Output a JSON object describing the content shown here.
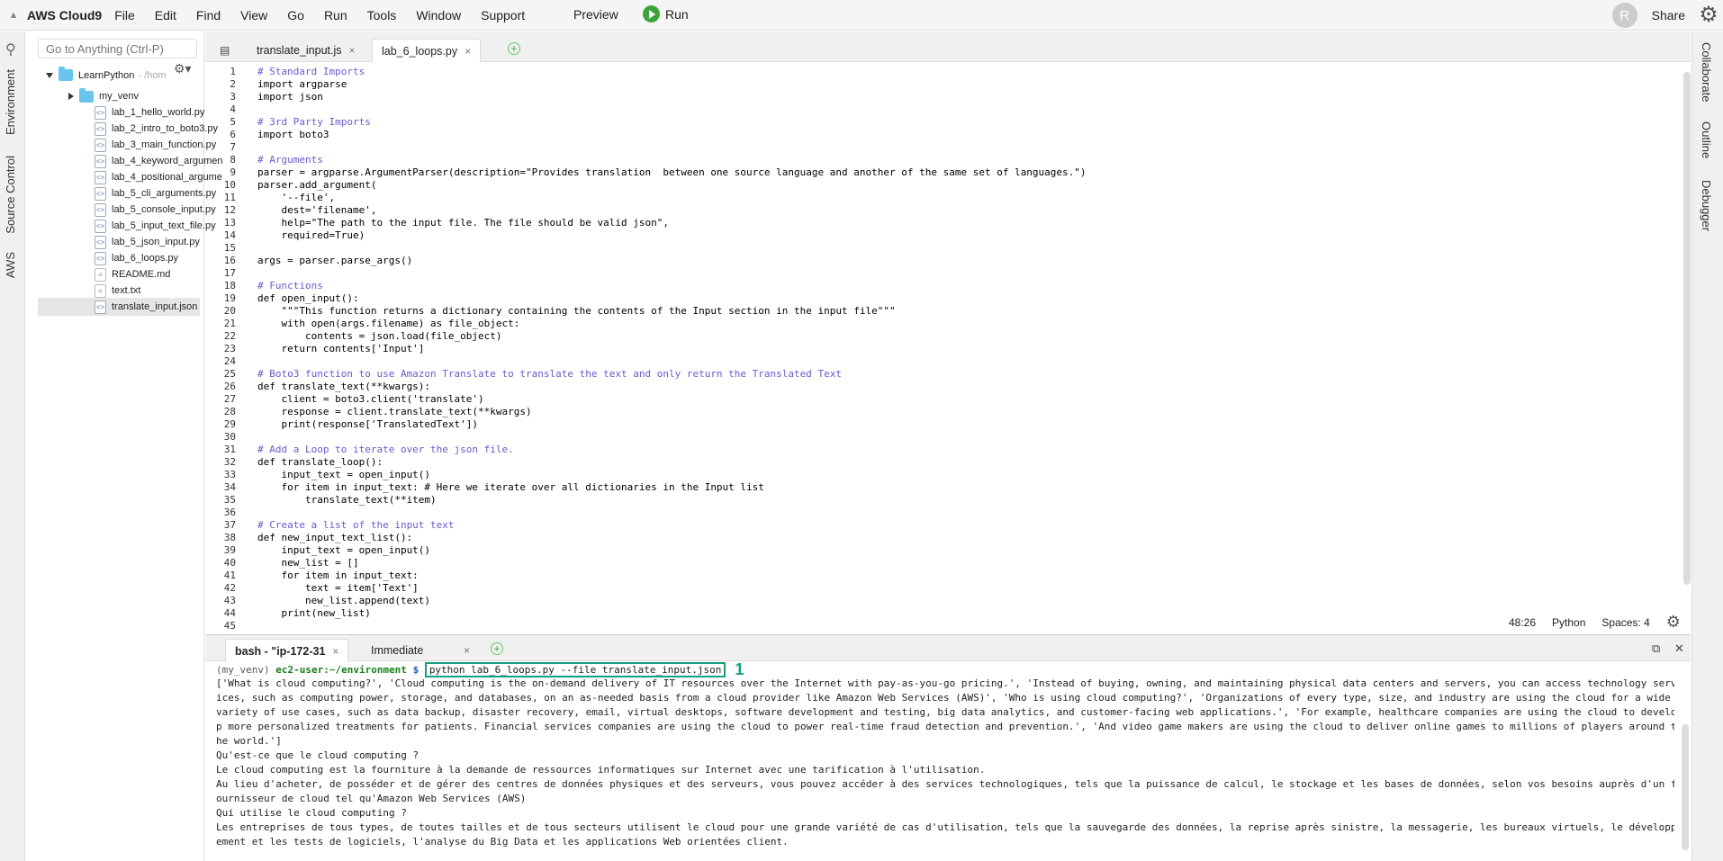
{
  "app": {
    "brand": "AWS Cloud9",
    "menu": [
      "File",
      "Edit",
      "Find",
      "View",
      "Go",
      "Run",
      "Tools",
      "Window",
      "Support"
    ],
    "preview_label": "Preview",
    "run_label": "Run",
    "avatar_letter": "R",
    "share_label": "Share"
  },
  "left_rail": {
    "tabs": [
      "Environment",
      "Source Control",
      "AWS"
    ]
  },
  "sidebar": {
    "goto_placeholder": "Go to Anything (Ctrl-P)",
    "root_name": "LearnPython",
    "root_path": "- /hom",
    "folders": [
      "my_venv"
    ],
    "files": [
      {
        "name": "lab_1_hello_world.py",
        "type": "py"
      },
      {
        "name": "lab_2_intro_to_boto3.py",
        "type": "py"
      },
      {
        "name": "lab_3_main_function.py",
        "type": "py"
      },
      {
        "name": "lab_4_keyword_argumen",
        "type": "py"
      },
      {
        "name": "lab_4_positional_argume",
        "type": "py"
      },
      {
        "name": "lab_5_cli_arguments.py",
        "type": "py"
      },
      {
        "name": "lab_5_console_input.py",
        "type": "py"
      },
      {
        "name": "lab_5_input_text_file.py",
        "type": "py"
      },
      {
        "name": "lab_5_json_input.py",
        "type": "py"
      },
      {
        "name": "lab_6_loops.py",
        "type": "py"
      },
      {
        "name": "README.md",
        "type": "doc"
      },
      {
        "name": "text.txt",
        "type": "doc"
      },
      {
        "name": "translate_input.json",
        "type": "json"
      }
    ],
    "selected_file": "translate_input.json"
  },
  "editor": {
    "tabs": [
      {
        "label": "translate_input.js",
        "close": "×"
      },
      {
        "label": "lab_6_loops.py",
        "close": "×"
      }
    ],
    "line_count": 45,
    "lines": [
      "# Standard Imports",
      "import argparse",
      "import json",
      "",
      "# 3rd Party Imports",
      "import boto3",
      "",
      "# Arguments",
      "parser = argparse.ArgumentParser(description=\"Provides translation  between one source language and another of the same set of languages.\")",
      "parser.add_argument(",
      "    '--file',",
      "    dest='filename',",
      "    help=\"The path to the input file. The file should be valid json\",",
      "    required=True)",
      "",
      "args = parser.parse_args()",
      "",
      "# Functions",
      "def open_input():",
      "    \"\"\"This function returns a dictionary containing the contents of the Input section in the input file\"\"\"",
      "    with open(args.filename) as file_object:",
      "        contents = json.load(file_object)",
      "    return contents['Input']",
      "",
      "# Boto3 function to use Amazon Translate to translate the text and only return the Translated Text",
      "def translate_text(**kwargs):",
      "    client = boto3.client('translate')",
      "    response = client.translate_text(**kwargs)",
      "    print(response['TranslatedText'])",
      "",
      "# Add a Loop to iterate over the json file.",
      "def translate_loop():",
      "    input_text = open_input()",
      "    for item in input_text: # Here we iterate over all dictionaries in the Input list",
      "        translate_text(**item)",
      "",
      "# Create a list of the input text",
      "def new_input_text_list():",
      "    input_text = open_input()",
      "    new_list = []",
      "    for item in input_text:",
      "        text = item['Text']",
      "        new_list.append(text)",
      "    print(new_list)",
      ""
    ]
  },
  "status_bar": {
    "cursor": "48:26",
    "language": "Python",
    "indent": "Spaces: 4"
  },
  "terminal": {
    "tabs": [
      {
        "label": "bash - \"ip-172-31",
        "close": "×"
      },
      {
        "label": "Immediate",
        "close": "×"
      }
    ],
    "prompt_venv": "(my_venv)",
    "prompt_user": "ec2-user:~/environment",
    "prompt_symbol": "$",
    "command": "python lab_6_loops.py --file translate_input.json",
    "annotation_number": "1",
    "output_lines": [
      "['What is cloud computing?', 'Cloud computing is the on-demand delivery of IT resources over the Internet with pay-as-you-go pricing.', 'Instead of buying, owning, and maintaining physical data centers and servers, you can access technology serv",
      "ices, such as computing power, storage, and databases, on an as-needed basis from a cloud provider like Amazon Web Services (AWS)', 'Who is using cloud computing?', 'Organizations of every type, size, and industry are using the cloud for a wide",
      "variety of use cases, such as data backup, disaster recovery, email, virtual desktops, software development and testing, big data analytics, and customer-facing web applications.', 'For example, healthcare companies are using the cloud to develo",
      "p more personalized treatments for patients. Financial services companies are using the cloud to power real-time fraud detection and prevention.', 'And video game makers are using the cloud to deliver online games to millions of players around t",
      "he world.']",
      "Qu'est-ce que le cloud computing ?",
      "Le cloud computing est la fourniture à la demande de ressources informatiques sur Internet avec une tarification à l'utilisation.",
      "Au lieu d'acheter, de posséder et de gérer des centres de données physiques et des serveurs, vous pouvez accéder à des services technologiques, tels que la puissance de calcul, le stockage et les bases de données, selon vos besoins auprès d'un f",
      "ournisseur de cloud tel qu'Amazon Web Services (AWS)",
      "Qui utilise le cloud computing ?",
      "Les entreprises de tous types, de toutes tailles et de tous secteurs utilisent le cloud pour une grande variété de cas d'utilisation, tels que la sauvegarde des données, la reprise après sinistre, la messagerie, les bureaux virtuels, le développ",
      "ement et les tests de logiciels, l'analyse du Big Data et les applications Web orientées client."
    ]
  },
  "right_rail": {
    "tabs": [
      "Collaborate",
      "Outline",
      "Debugger"
    ]
  }
}
